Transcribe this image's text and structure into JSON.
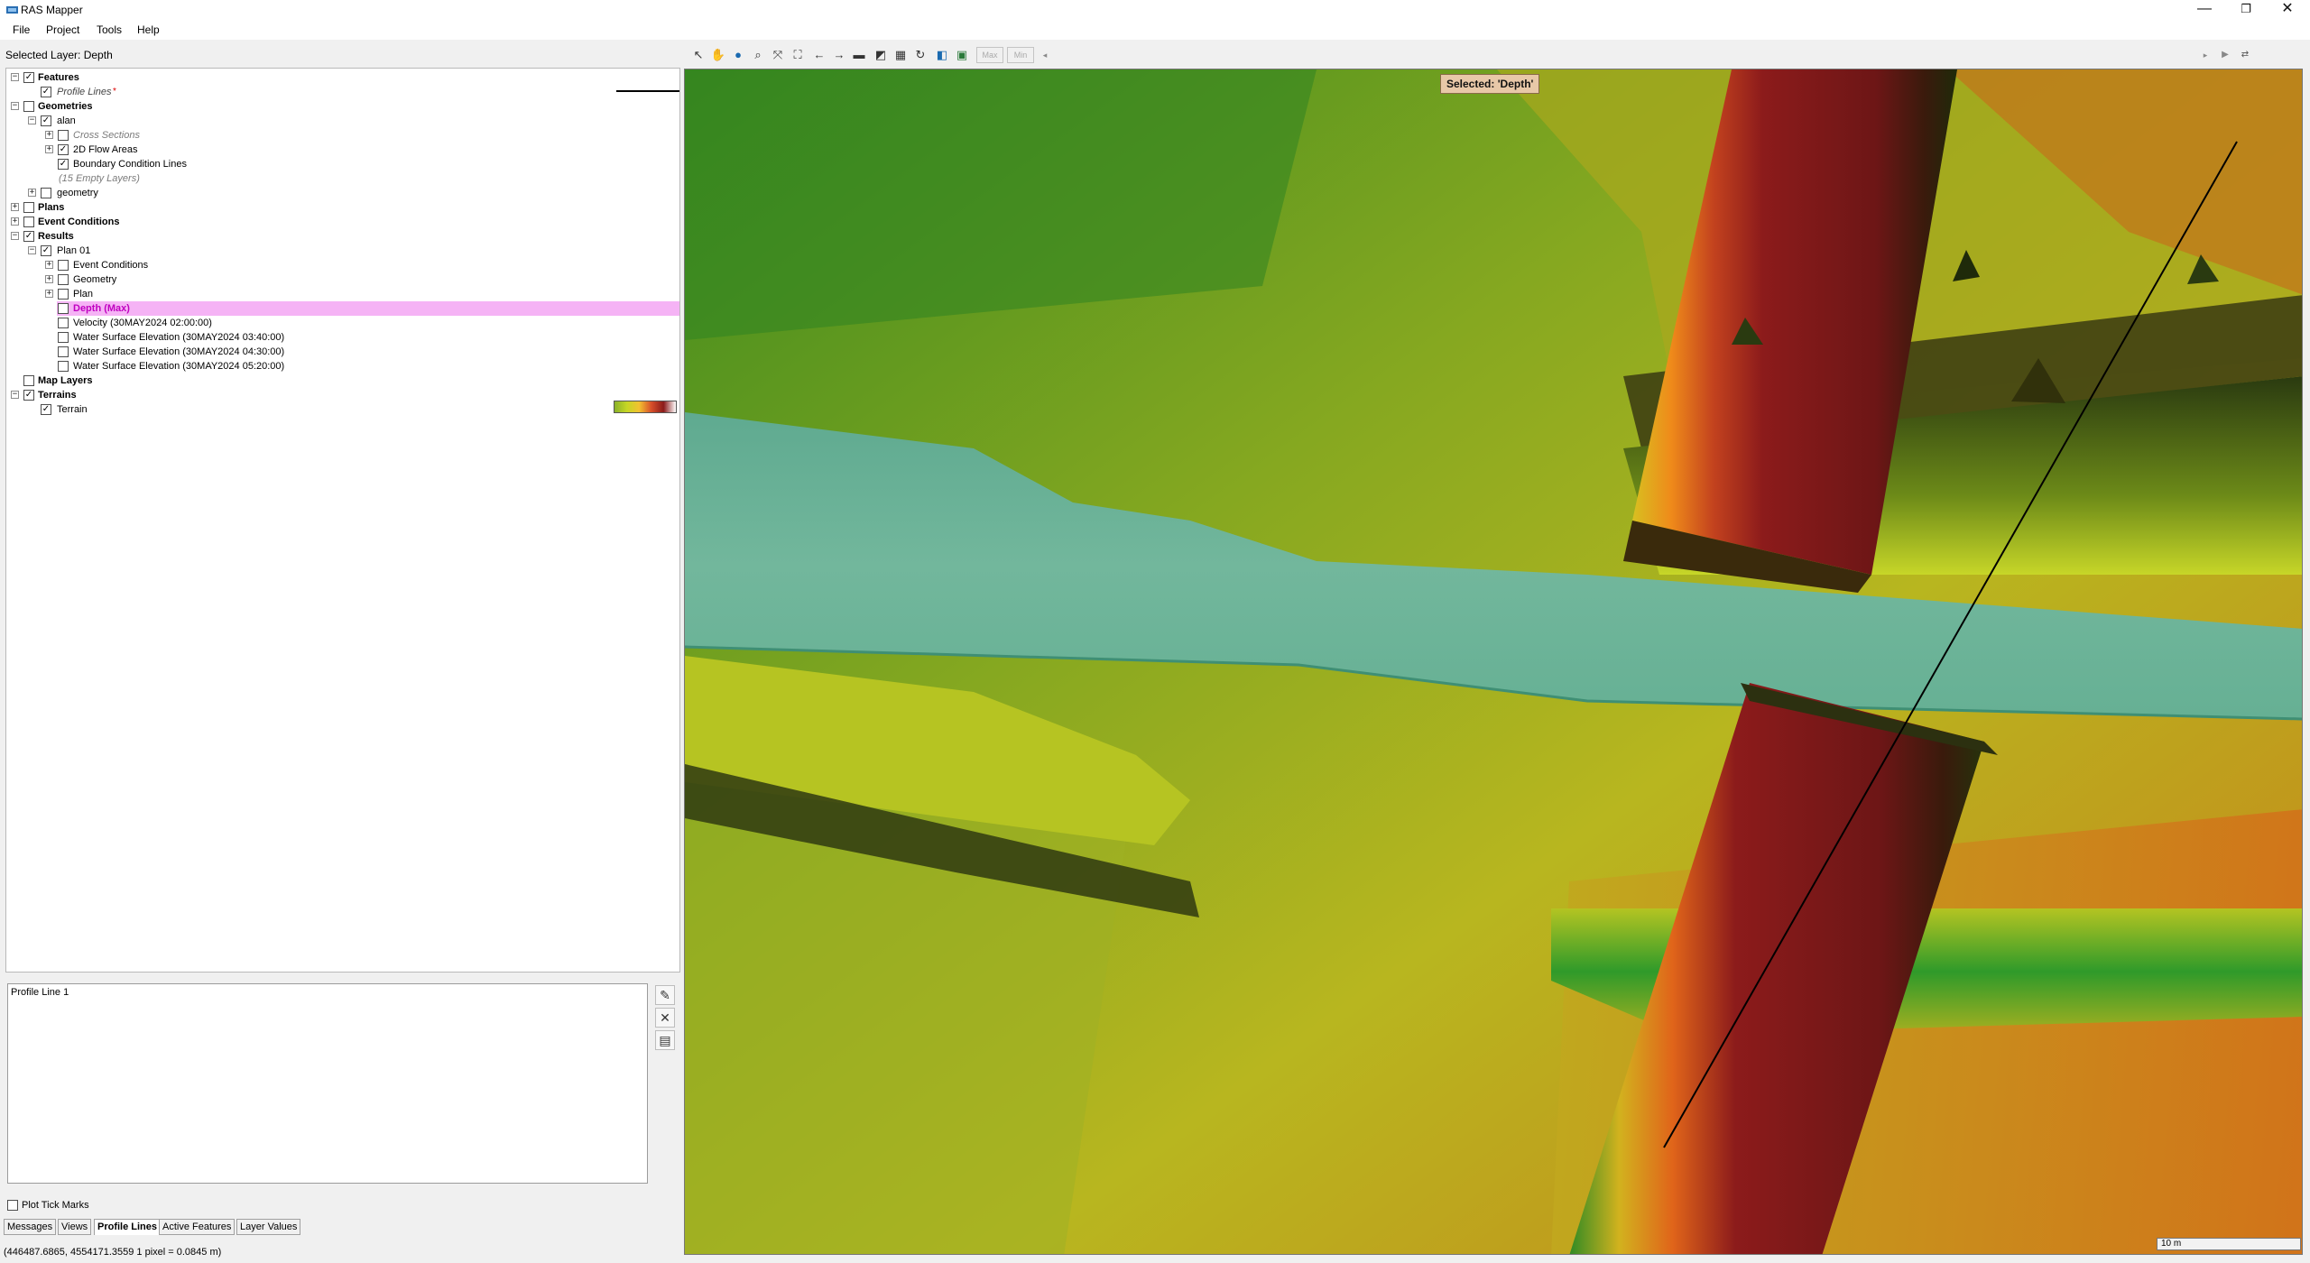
{
  "window": {
    "title": "RAS Mapper",
    "controls": [
      "—",
      "❐",
      "✕"
    ]
  },
  "menu": [
    "File",
    "Project",
    "Tools",
    "Help"
  ],
  "selected_layer_label": "Selected Layer: Depth",
  "tree": {
    "features": "Features",
    "profile_lines": "Profile Lines",
    "profile_lines_marker": "*",
    "geometries": "Geometries",
    "alan": "alan",
    "cross_sections": "Cross Sections",
    "flow_areas": "2D Flow Areas",
    "bc_lines": "Boundary Condition Lines",
    "empty_layers": "(15 Empty Layers)",
    "geometry": "geometry",
    "plans": "Plans",
    "event_conditions": "Event Conditions",
    "results": "Results",
    "plan01": "Plan 01",
    "r_event_conditions": "Event Conditions",
    "r_geometry": "Geometry",
    "r_plan": "Plan",
    "depth_max": "Depth (Max)",
    "velocity": "Velocity (30MAY2024 02:00:00)",
    "wse1": "Water Surface Elevation (30MAY2024 03:40:00)",
    "wse2": "Water Surface Elevation (30MAY2024 04:30:00)",
    "wse3": "Water Surface Elevation (30MAY2024 05:20:00)",
    "map_layers": "Map Layers",
    "terrains": "Terrains",
    "terrain": "Terrain"
  },
  "profile_panel": {
    "item": "Profile Line 1",
    "plot_tick_marks": "Plot Tick Marks"
  },
  "tabs": [
    "Messages",
    "Views",
    "Profile Lines",
    "Active Features",
    "Layer Values"
  ],
  "active_tab": "Profile Lines",
  "status": "(446487.6865, 4554171.3559  1 pixel = 0.0845 m)",
  "toolbar": {
    "max_label": "Max",
    "min_label": "Min"
  },
  "map": {
    "selected_badge": "Selected: 'Depth'",
    "scale_label": "10 m"
  },
  "colors": {
    "deep_red": "#8c1b1b",
    "orange": "#e07a1e",
    "yellow_green": "#c3cf25",
    "green": "#3c9a24",
    "water": "#6fb59a",
    "highlight": "#f5b3f5"
  }
}
